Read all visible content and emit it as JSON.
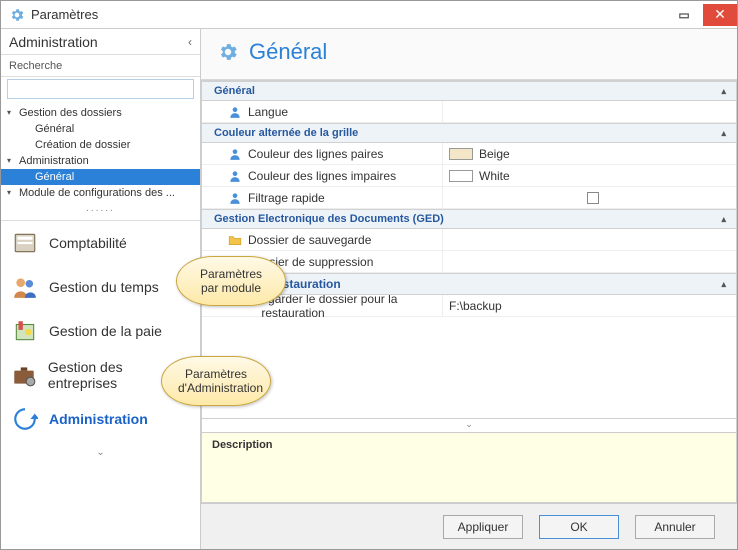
{
  "window": {
    "title": "Paramètres"
  },
  "sidebar": {
    "header": "Administration",
    "search_label": "Recherche",
    "tree": {
      "items": [
        {
          "label": "Gestion des dossiers",
          "level": 1,
          "expand": true
        },
        {
          "label": "Général",
          "level": 2
        },
        {
          "label": "Création de dossier",
          "level": 2
        },
        {
          "label": "Administration",
          "level": 1,
          "expand": true
        },
        {
          "label": "Général",
          "level": 2,
          "selected": true
        },
        {
          "label": "Module de configurations des ...",
          "level": 1,
          "expand": true
        }
      ],
      "more": "......"
    },
    "modules": [
      {
        "label": "Comptabilité",
        "icon": "ledger"
      },
      {
        "label": "Gestion du temps",
        "icon": "people"
      },
      {
        "label": "Gestion de la paie",
        "icon": "payroll"
      },
      {
        "label": "Gestion des entreprises",
        "icon": "briefcase-gear"
      },
      {
        "label": "Administration",
        "icon": "refresh",
        "active": true
      }
    ]
  },
  "main": {
    "title": "Général",
    "groups": [
      {
        "title": "Général",
        "rows": [
          {
            "label": "Langue",
            "icon": "person",
            "value": ""
          }
        ]
      },
      {
        "title": "Couleur alternée de la grille",
        "rows": [
          {
            "label": "Couleur des lignes paires",
            "icon": "person",
            "value_type": "color",
            "swatch": "#f3e7c8",
            "value": "Beige"
          },
          {
            "label": "Couleur des lignes impaires",
            "icon": "person",
            "value_type": "color",
            "swatch": "#ffffff",
            "value": "White"
          },
          {
            "label": "Filtrage rapide",
            "icon": "person",
            "value_type": "checkbox",
            "checked": false
          }
        ]
      },
      {
        "title": "Gestion Electronique des Documents (GED)",
        "rows": [
          {
            "label": "Dossier de sauvegarde",
            "icon": "folder",
            "value": ""
          },
          {
            "label": "Dossier de suppression",
            "icon": "folder",
            "value": ""
          }
        ]
      },
      {
        "title": "Points de restauration",
        "title_partial": "ts de restauration",
        "rows": [
          {
            "label_visible": "egarder le dossier pour la restauration",
            "label": "Sauvegarder le dossier pour la restauration",
            "icon": "folder",
            "value": "F:\\backup"
          }
        ]
      }
    ],
    "description_label": "Description"
  },
  "buttons": {
    "apply": "Appliquer",
    "ok": "OK",
    "cancel": "Annuler"
  },
  "callouts": {
    "c1": "Paramètres par module",
    "c2": "Paramètres d'Administration"
  },
  "icons": {
    "gear": "gear-icon",
    "person": "person-icon",
    "folder": "folder-icon"
  }
}
